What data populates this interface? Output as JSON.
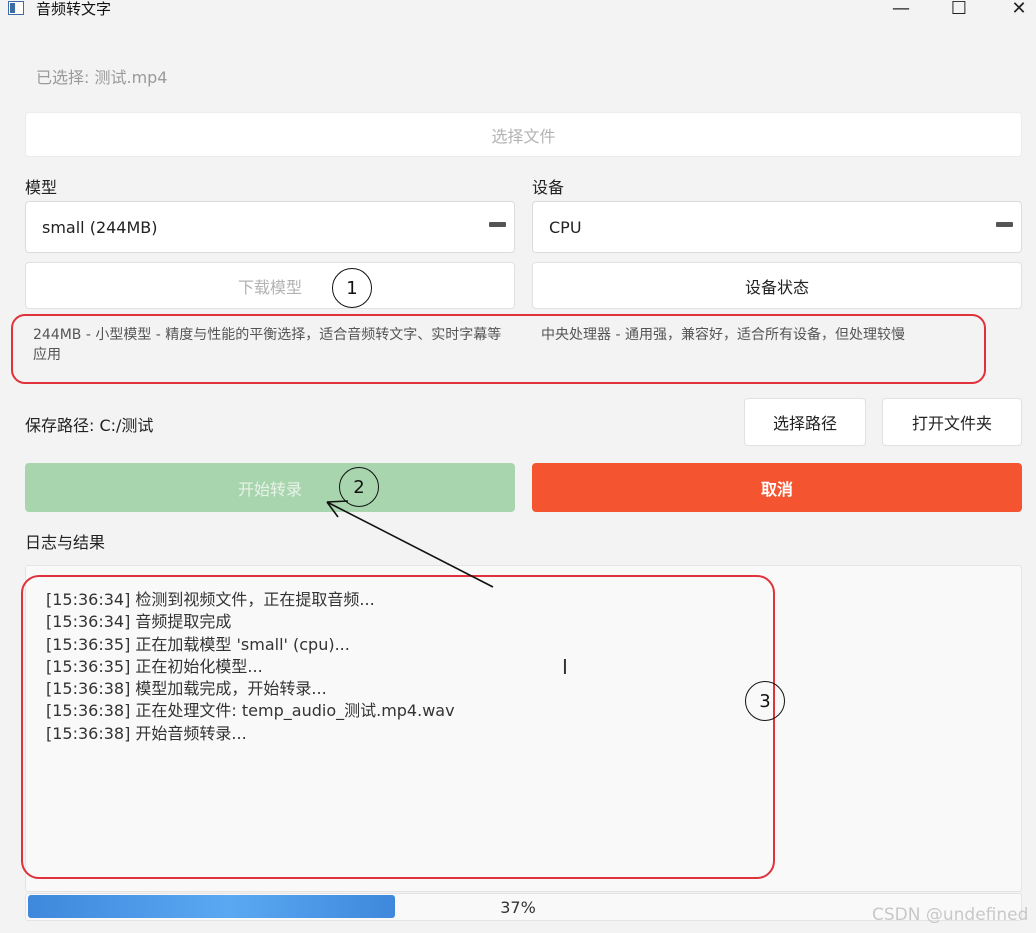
{
  "window": {
    "title": "音频转文字",
    "minimize_glyph": "—",
    "maximize_glyph": "☐",
    "close_glyph": "✕"
  },
  "file": {
    "selected_text": "已选择: 测试.mp4",
    "select_button": "选择文件"
  },
  "model": {
    "label": "模型",
    "selected": "small (244MB)",
    "download_button": "下载模型",
    "description": "244MB - 小型模型 - 精度与性能的平衡选择，适合音频转文字、实时字幕等应用"
  },
  "device": {
    "label": "设备",
    "selected": "CPU",
    "status_button": "设备状态",
    "description": "中央处理器 - 通用强，兼容好，适合所有设备，但处理较慢"
  },
  "save": {
    "path_text": "保存路径: C:/测试",
    "choose_path_button": "选择路径",
    "open_folder_button": "打开文件夹"
  },
  "actions": {
    "start_button": "开始转录",
    "cancel_button": "取消"
  },
  "log": {
    "label": "日志与结果",
    "lines": [
      "[15:36:34] 检测到视频文件，正在提取音频...",
      "[15:36:34] 音频提取完成",
      "[15:36:35] 正在加载模型 'small' (cpu)...",
      "[15:36:35] 正在初始化模型...",
      "[15:36:38] 模型加载完成，开始转录...",
      "[15:36:38] 正在处理文件: temp_audio_测试.mp4.wav",
      "[15:36:38] 开始音频转录..."
    ]
  },
  "progress": {
    "value": 0.37,
    "text": "37%"
  },
  "annotations": {
    "circle_1": "1",
    "circle_2": "2",
    "circle_3": "3",
    "color": "#e0323a"
  },
  "watermark": "CSDN @undefined",
  "colors": {
    "start_button_disabled": "#a8d5ae",
    "cancel_button": "#f4542f",
    "progress_fill": "#4a97e6"
  }
}
